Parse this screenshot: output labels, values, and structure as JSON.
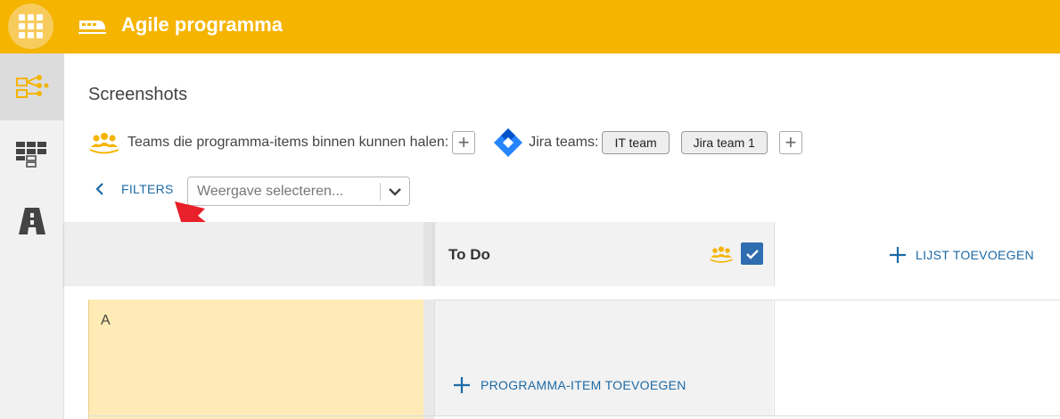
{
  "header": {
    "app_title": "Agile programma",
    "apps_icon": "apps-grid-icon",
    "logo_icon": "train-icon",
    "color": "#f5b400"
  },
  "rail": {
    "items": [
      {
        "icon": "hierarchy-icon",
        "active": true
      },
      {
        "icon": "board-icon",
        "active": false
      },
      {
        "icon": "road-icon",
        "active": false
      }
    ]
  },
  "page": {
    "title": "Screenshots"
  },
  "teams": {
    "label": "Teams die programma-items binnen kunnen halen:",
    "add_symbol": "+",
    "jira_label": "Jira teams:",
    "jira_chips": [
      "IT team",
      "Jira team 1"
    ]
  },
  "filters": {
    "label": "FILTERS",
    "view_placeholder": "Weergave selecteren..."
  },
  "board": {
    "column_title": "To Do",
    "add_list_label": "LIJST TOEVOEGEN",
    "row_label": "A",
    "add_item_label": "PROGRAMMA-ITEM TOEVOEGEN"
  },
  "colors": {
    "accent": "#f5b400",
    "link": "#1c6aa6",
    "checkbox": "#2f6db0",
    "row_highlight": "#feebb5",
    "annotation_arrow": "#e8202a"
  }
}
